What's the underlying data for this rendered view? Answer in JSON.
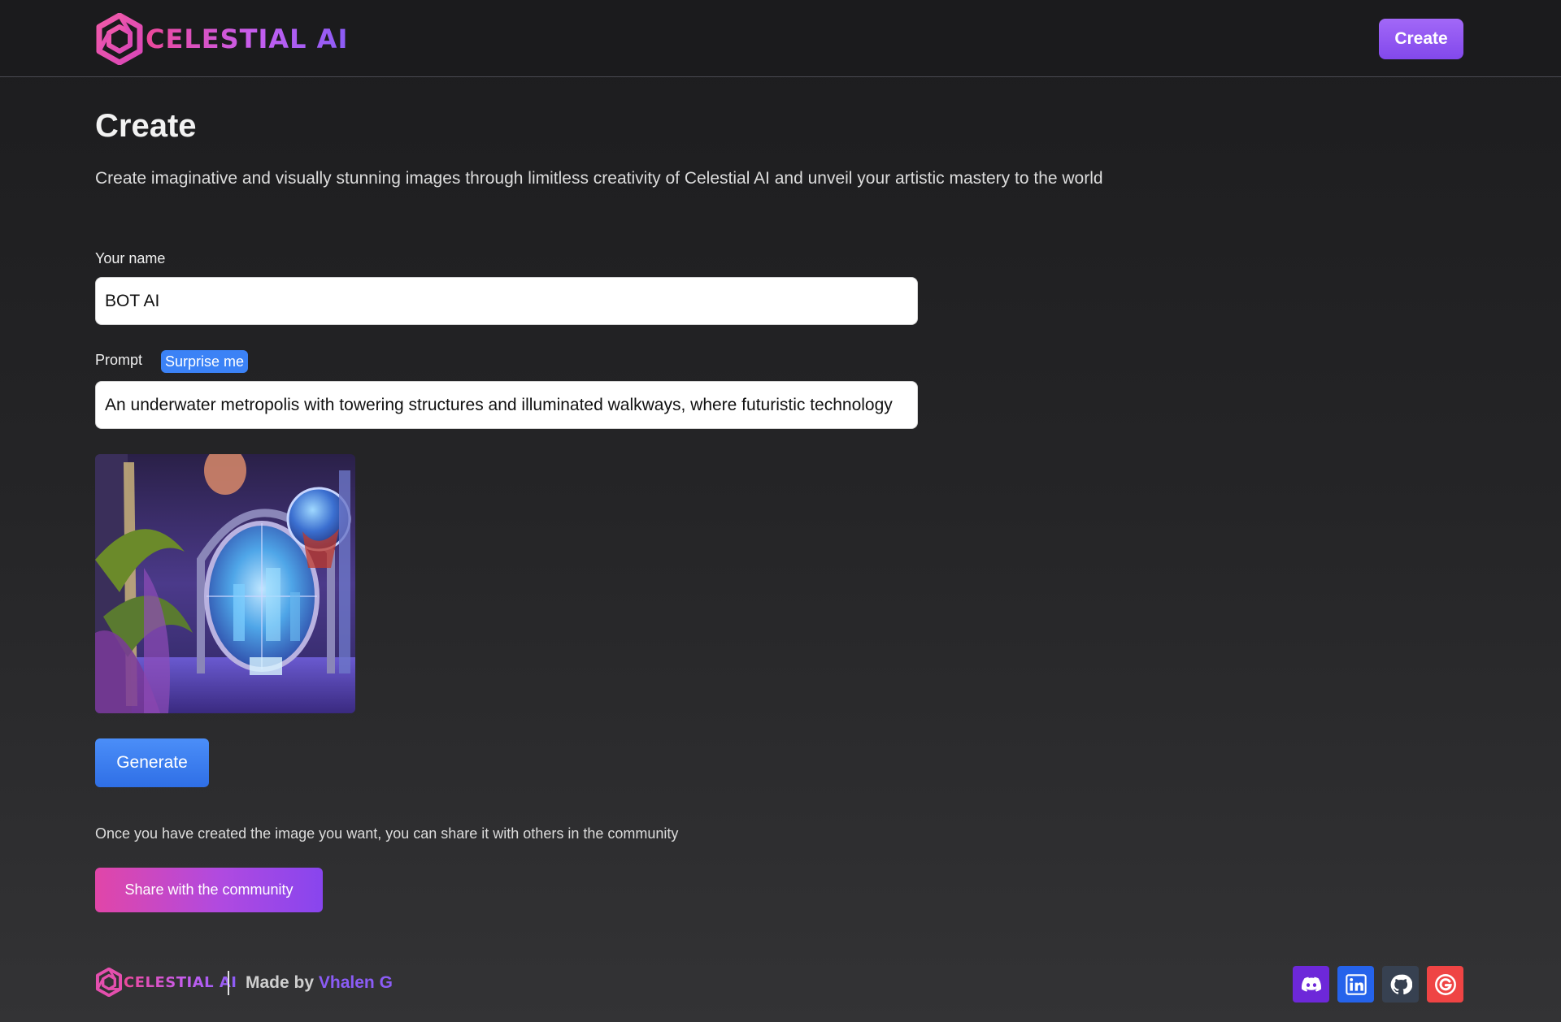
{
  "brand": {
    "name": "CELESTIAL AI",
    "gradient": [
      "#ec4899",
      "#8b5cf6"
    ]
  },
  "header": {
    "create_label": "Create"
  },
  "main": {
    "title": "Create",
    "subtitle": "Create imaginative and visually stunning images through limitless creativity of Celestial AI and unveil your artistic mastery to the world",
    "name_label": "Your name",
    "name_value": "BOT AI",
    "prompt_label": "Prompt",
    "surprise_label": "Surprise me",
    "prompt_value": "An underwater metropolis with towering structures and illuminated walkways, where futuristic technology",
    "generated_image": "underwater-metropolis-artwork",
    "generate_label": "Generate",
    "share_hint": "Once you have created the image you want, you can share it with others in the community",
    "share_label": "Share with the community"
  },
  "footer": {
    "brand": "CELESTIAL AI",
    "made_by_prefix": "Made by",
    "author": "Vhalen G",
    "socials": [
      {
        "name": "discord-icon",
        "color": "#6d28d9"
      },
      {
        "name": "linkedin-icon",
        "color": "#2563eb"
      },
      {
        "name": "github-icon",
        "color": "#374151"
      },
      {
        "name": "google-icon",
        "color": "#ef4444"
      }
    ]
  },
  "colors": {
    "accent_purple": "#8b5cf6",
    "accent_blue": "#3b82f6",
    "accent_pink": "#ec4899",
    "background": "#1c1c1e"
  }
}
